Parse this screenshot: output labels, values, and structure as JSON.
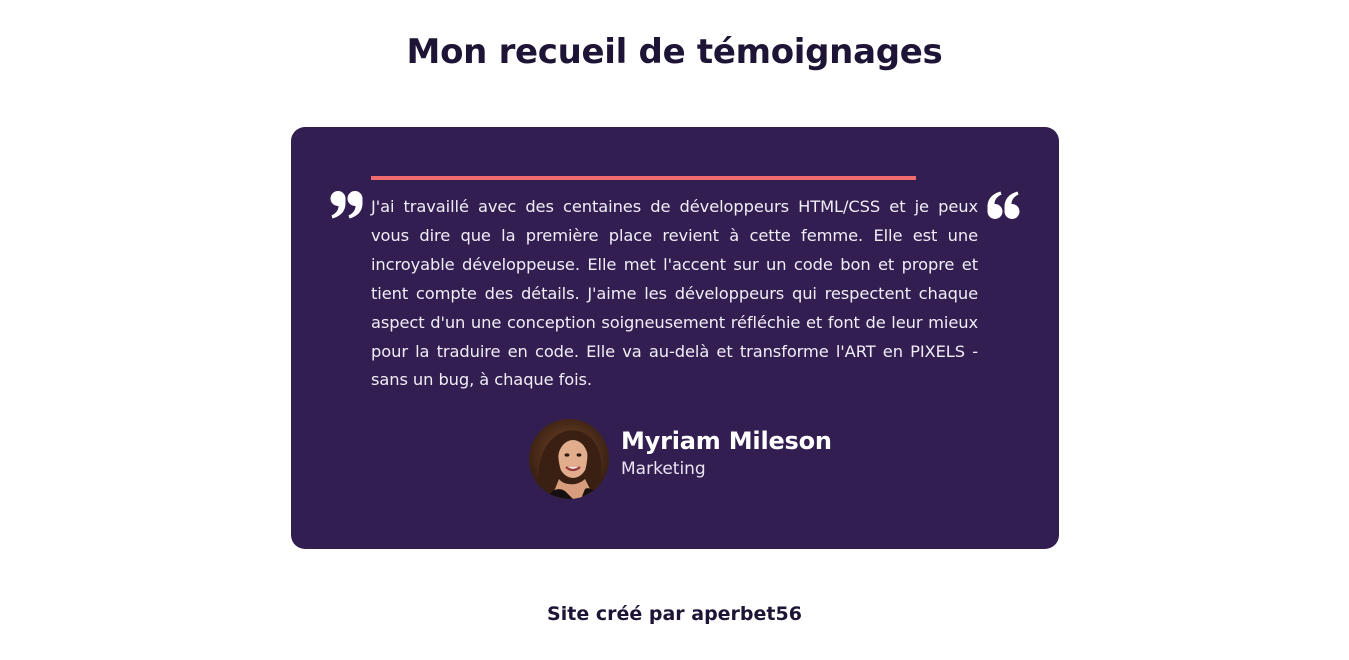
{
  "header": {
    "title": "Mon recueil de témoignages"
  },
  "testimonial": {
    "quote": "J'ai travaillé avec des centaines de développeurs HTML/CSS et je peux vous dire que la première place revient à cette femme. Elle est une incroyable développeuse. Elle met l'accent sur un code bon et propre et tient compte des détails. J'aime les développeurs qui respectent chaque aspect d'un une conception soigneusement réfléchie et font de leur mieux pour la traduire en code. Elle va au-delà et transforme l'ART en PIXELS - sans un bug, à chaque fois.",
    "author_name": "Myriam Mileson",
    "author_role": "Marketing",
    "icons": {
      "open_quote": "quote-open-icon",
      "close_quote": "quote-close-icon"
    }
  },
  "footer": {
    "credit": "Site créé par aperbet56"
  },
  "colors": {
    "title": "#1e1536",
    "card_background": "#321e50",
    "accent": "#f26b6f",
    "text_light": "#f1edf7"
  }
}
